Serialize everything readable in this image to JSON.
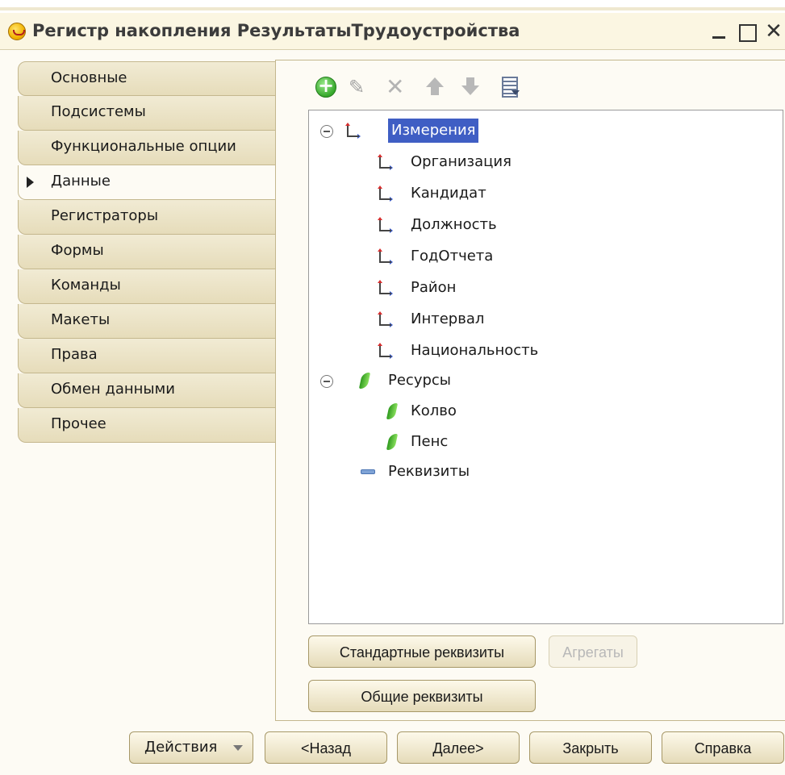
{
  "window": {
    "title": "Регистр накопления РезультатыТрудоустройства",
    "close_glyph": "✕"
  },
  "tabs": [
    {
      "label": "Основные",
      "active": false
    },
    {
      "label": "Подсистемы",
      "active": false
    },
    {
      "label": "Функциональные опции",
      "active": false
    },
    {
      "label": "Данные",
      "active": true
    },
    {
      "label": "Регистраторы",
      "active": false
    },
    {
      "label": "Формы",
      "active": false
    },
    {
      "label": "Команды",
      "active": false
    },
    {
      "label": "Макеты",
      "active": false
    },
    {
      "label": "Права",
      "active": false
    },
    {
      "label": "Обмен данными",
      "active": false
    },
    {
      "label": "Прочее",
      "active": false
    }
  ],
  "toolbar": {
    "icons": [
      "add-icon",
      "edit-icon",
      "delete-icon",
      "move-up-icon",
      "move-down-icon",
      "sort-list-icon"
    ],
    "edit_glyph": "✎",
    "delete_glyph": "✕"
  },
  "tree": {
    "dimensions": {
      "label": "Измерения",
      "selected": true,
      "items": [
        "Организация",
        "Кандидат",
        "Должность",
        "ГодОтчета",
        "Район",
        "Интервал",
        "Национальность"
      ]
    },
    "resources": {
      "label": "Ресурсы",
      "items": [
        "Колво",
        "Пенс"
      ]
    },
    "attributes": {
      "label": "Реквизиты"
    }
  },
  "panel_buttons": {
    "standard_attributes": "Стандартные реквизиты",
    "aggregates": "Агрегаты",
    "common_attributes": "Общие реквизиты"
  },
  "footer_buttons": {
    "actions": "Действия",
    "back": "<Назад",
    "next": "Далее>",
    "close": "Закрыть",
    "help": "Справка"
  },
  "colors": {
    "selection": "#3f5ec4",
    "tab_bg": "#e9e0c2",
    "window_bg": "#fdfbf4"
  }
}
